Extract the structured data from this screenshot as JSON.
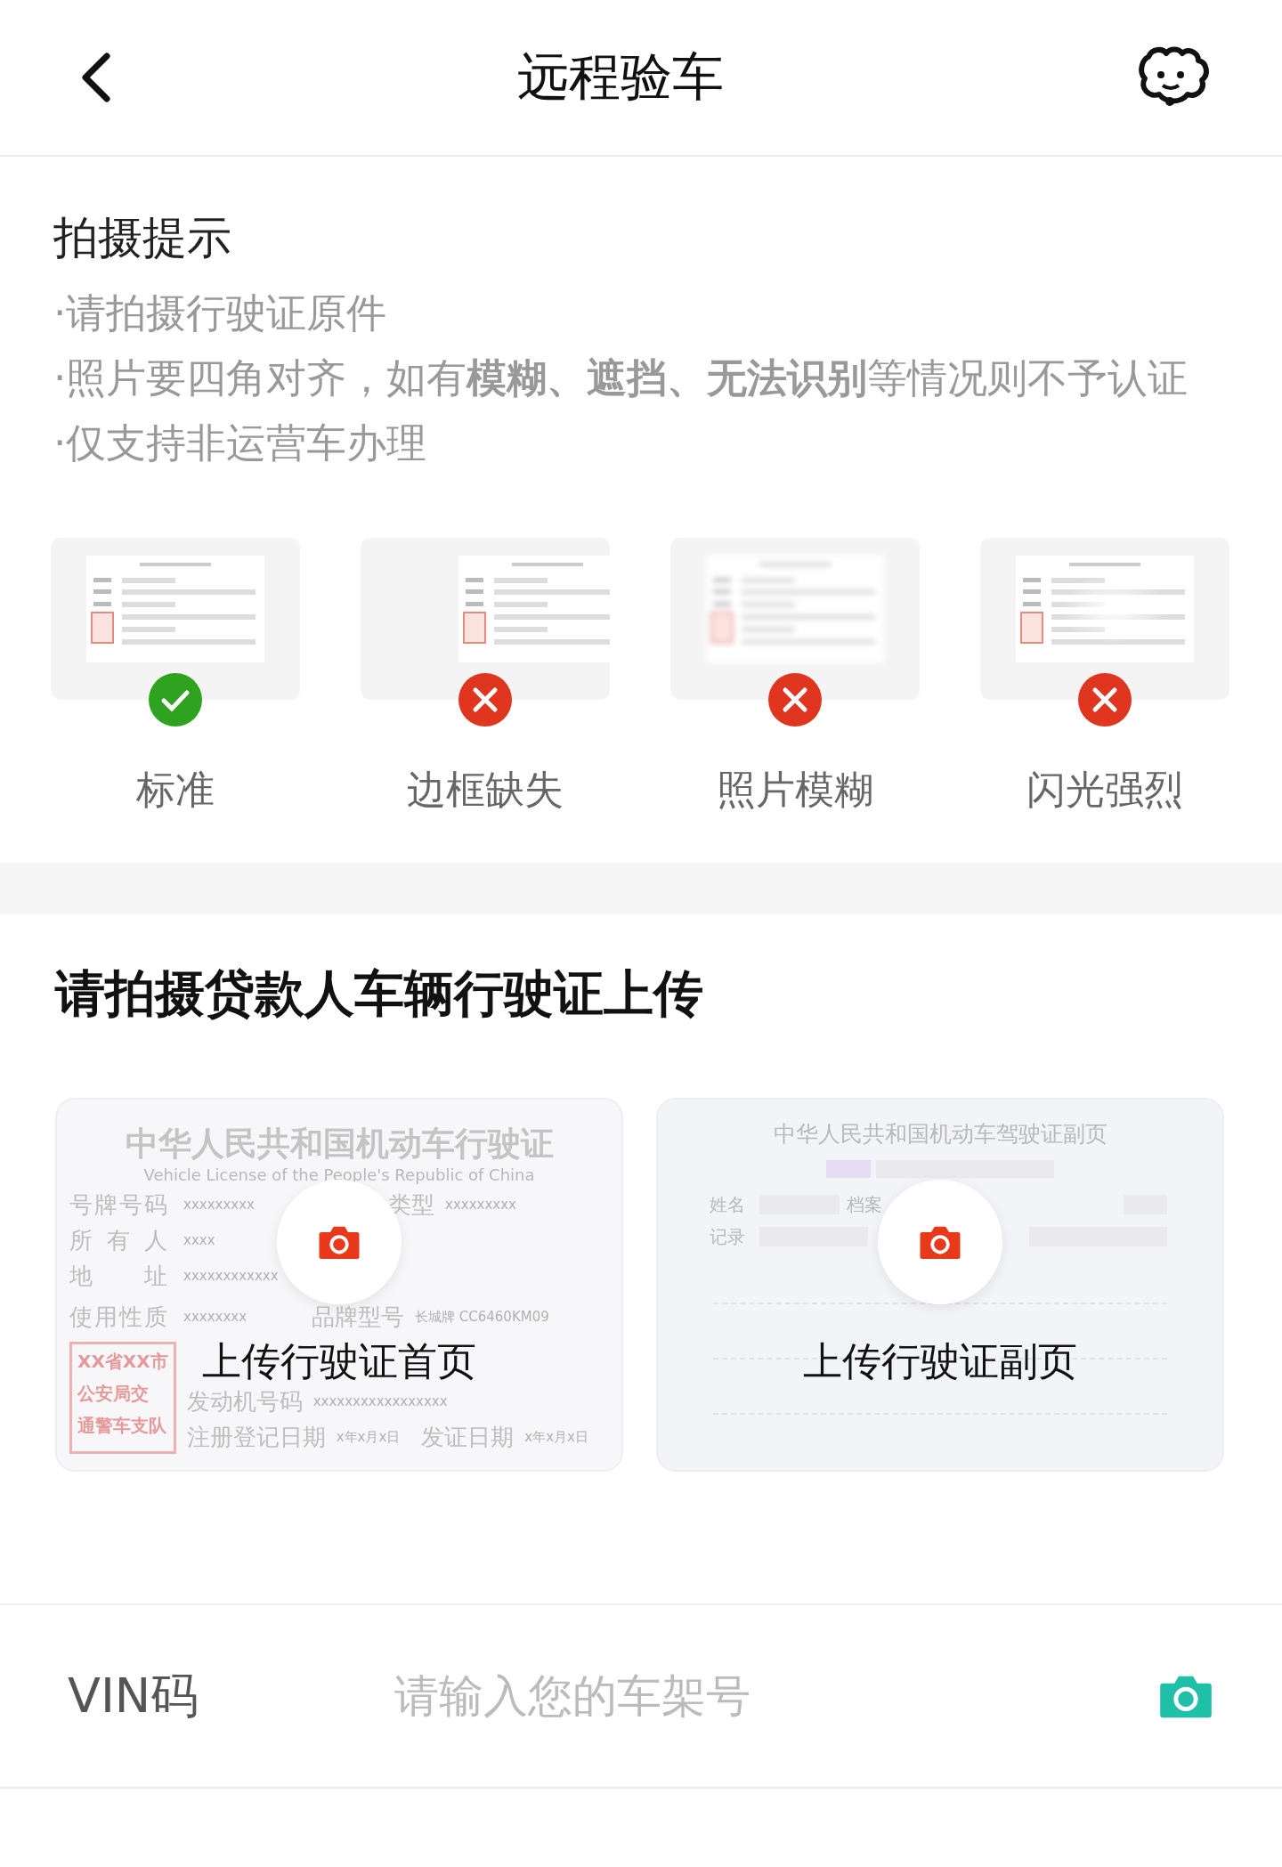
{
  "header": {
    "title": "远程验车"
  },
  "tips": {
    "title": "拍摄提示",
    "items": [
      "·请拍摄行驶证原件",
      "·照片要四角对齐，如有**模糊、遮挡、无法识别**等情况则不予认证",
      "·仅支持非运营车办理"
    ]
  },
  "examples": [
    {
      "label": "标准",
      "kind": "standard"
    },
    {
      "label": "边框缺失",
      "kind": "cropped"
    },
    {
      "label": "照片模糊",
      "kind": "blurred"
    },
    {
      "label": "闪光强烈",
      "kind": "glare"
    }
  ],
  "upload": {
    "title": "请拍摄贷款人车辆行驶证上传",
    "cards": [
      {
        "kind": "front",
        "label": "上传行驶证首页",
        "sample": {
          "title": "中华人民共和国机动车行驶证",
          "subtitle": "Vehicle License of the People's Republic of China",
          "rows": [
            [
              "号牌号码",
              "xxxxxxxxx",
              "类型",
              "xxxxxxxxx"
            ],
            [
              "所有人",
              "xxxx"
            ],
            [
              "地址",
              "xxxxxxxxxxxx"
            ],
            [
              "使用性质",
              "xxxxxxxx",
              "品牌型号",
              "长城牌 CC6460KM09"
            ]
          ],
          "stamp": [
            "XX省XX市",
            "公安局交",
            "通警车支队"
          ],
          "lower_rows": [
            [
              "发动机号码",
              "xxxxxxxxxxxxxxxxx"
            ],
            [
              "注册登记日期",
              "x年x月x日",
              "发证日期",
              "x年x月x日"
            ]
          ]
        }
      },
      {
        "kind": "back",
        "label": "上传行驶证副页",
        "sample": {
          "title": "中华人民共和国机动车驾驶证副页",
          "rows": [
            [
              "姓名",
              "档案"
            ],
            [
              "记录"
            ]
          ]
        }
      }
    ]
  },
  "vin": {
    "label": "VIN码",
    "placeholder": "请输入您的车架号"
  }
}
